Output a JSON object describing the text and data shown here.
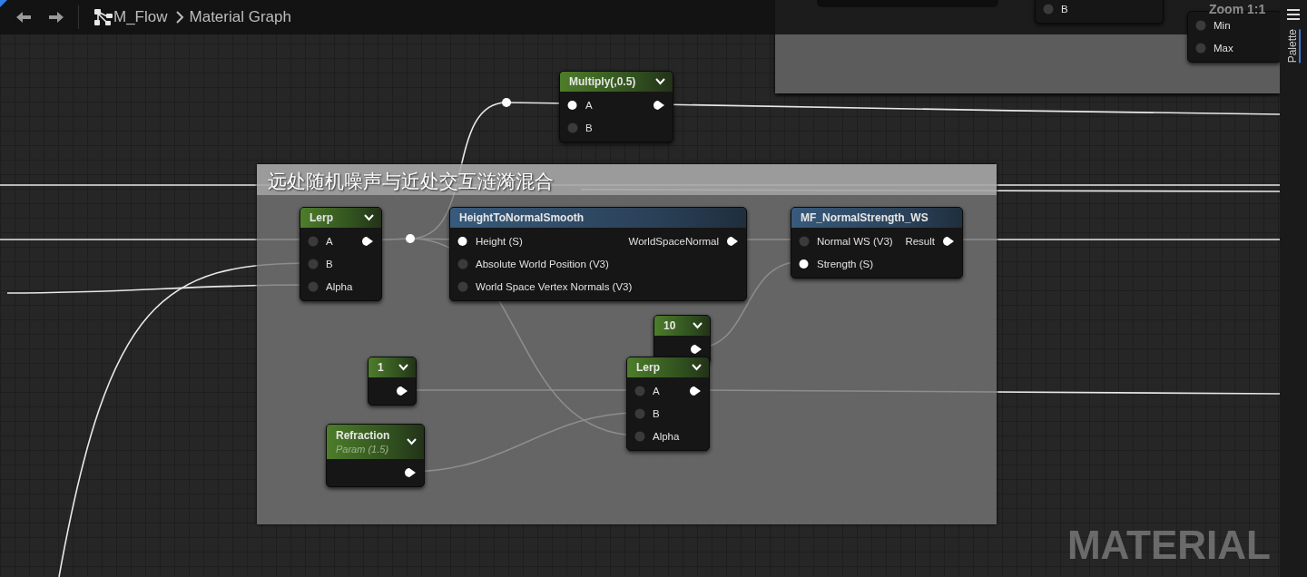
{
  "toolbar": {
    "breadcrumb": [
      "M_Flow",
      "Material Graph"
    ]
  },
  "zoom_label": "Zoom 1:1",
  "side_tab": {
    "label": "Palette"
  },
  "comments": [
    {
      "title": "远处随机噪声与近处交互涟漪混合"
    }
  ],
  "nodes": [
    {
      "kind": "fragment",
      "rows": [
        {
          "in": {
            "label": "B",
            "connected": false
          }
        }
      ]
    },
    {
      "kind": "fragment",
      "rows": [
        {
          "in": {
            "label": "Min",
            "connected": false
          }
        },
        {
          "in": {
            "label": "Max",
            "connected": false
          }
        }
      ]
    },
    {
      "kind": "math",
      "title": "Multiply(,0.5)",
      "chevron": true,
      "rows": [
        {
          "in": {
            "label": "A",
            "connected": true
          },
          "out": {
            "connected": true
          }
        },
        {
          "in": {
            "label": "B",
            "connected": false
          }
        }
      ]
    },
    {
      "kind": "math",
      "title": "Lerp",
      "chevron": true,
      "rows": [
        {
          "in": {
            "label": "A",
            "connected": false
          },
          "out": {
            "connected": true
          }
        },
        {
          "in": {
            "label": "B",
            "connected": false
          }
        },
        {
          "in": {
            "label": "Alpha",
            "connected": false
          }
        }
      ]
    },
    {
      "kind": "function",
      "title": "HeightToNormalSmooth",
      "chevron": false,
      "rows": [
        {
          "in": {
            "label": "Height (S)",
            "connected": true
          },
          "out": {
            "label": "WorldSpaceNormal",
            "connected": true
          }
        },
        {
          "in": {
            "label": "Absolute World Position (V3)",
            "connected": false
          }
        },
        {
          "in": {
            "label": "World Space Vertex Normals (V3)",
            "connected": false
          }
        }
      ]
    },
    {
      "kind": "function",
      "title": "MF_NormalStrength_WS",
      "chevron": false,
      "rows": [
        {
          "in": {
            "label": "Normal WS (V3)",
            "connected": false
          },
          "out": {
            "label": "Result",
            "connected": true
          }
        },
        {
          "in": {
            "label": "Strength (S)",
            "connected": true
          }
        }
      ]
    },
    {
      "kind": "constant",
      "title": "10",
      "chevron": true,
      "rows": [
        {
          "out": {
            "connected": true
          }
        }
      ]
    },
    {
      "kind": "constant",
      "title": "1",
      "chevron": true,
      "rows": [
        {
          "out": {
            "connected": true
          }
        }
      ]
    },
    {
      "kind": "math",
      "title": "Lerp",
      "chevron": true,
      "rows": [
        {
          "in": {
            "label": "A",
            "connected": false
          },
          "out": {
            "connected": true
          }
        },
        {
          "in": {
            "label": "B",
            "connected": false
          }
        },
        {
          "in": {
            "label": "Alpha",
            "connected": false
          }
        }
      ]
    },
    {
      "kind": "parameter",
      "title": "Refraction",
      "subtitle": "Param (1.5)",
      "chevron": true,
      "rows": [
        {
          "out": {
            "connected": true
          }
        }
      ]
    }
  ],
  "graph_type_label": "MATERIAL"
}
